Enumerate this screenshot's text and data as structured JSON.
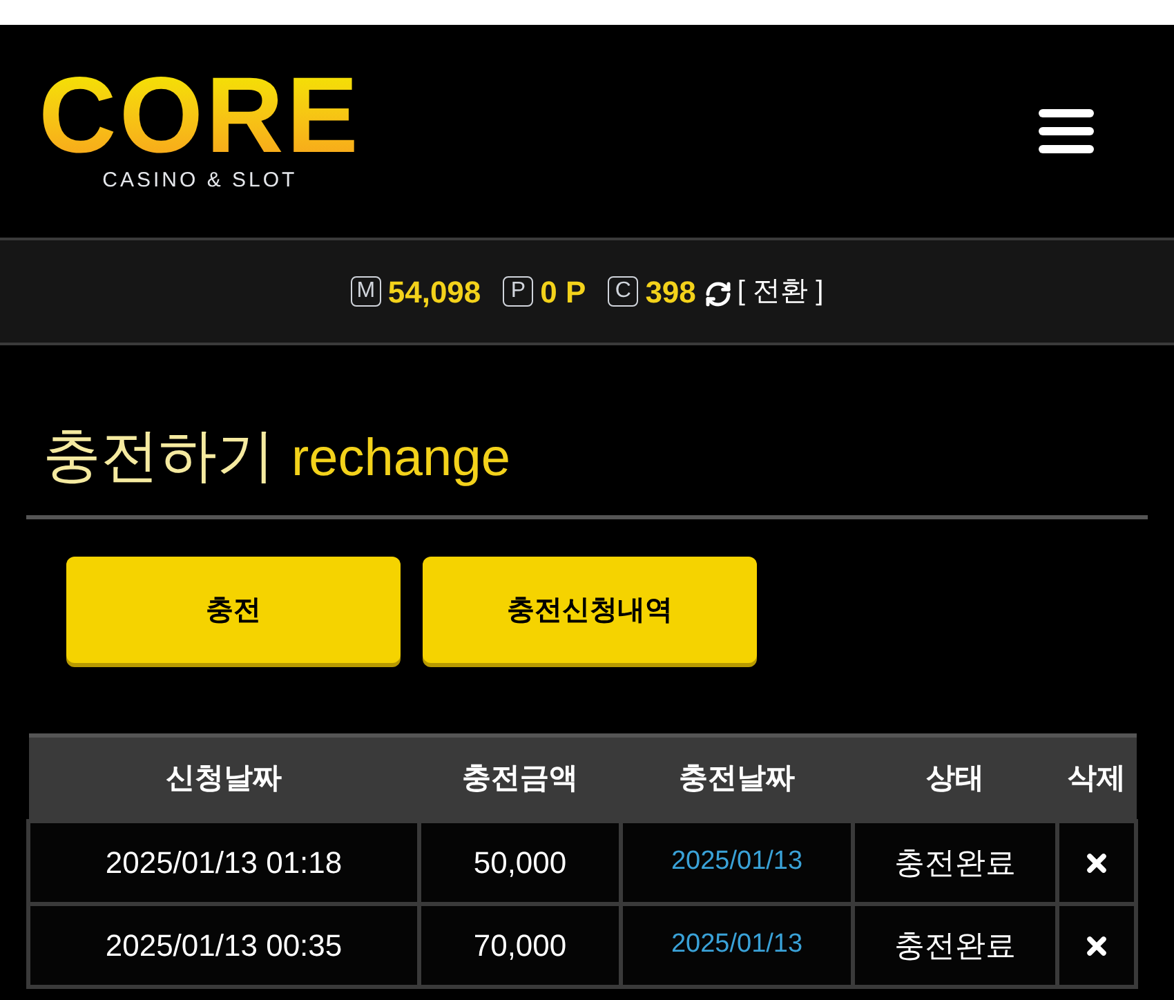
{
  "logo": {
    "wordmark": "CORE",
    "tagline": "CASINO & SLOT"
  },
  "balance": {
    "items": [
      {
        "badge": "M",
        "value": "54,098"
      },
      {
        "badge": "P",
        "value": "0 P"
      },
      {
        "badge": "C",
        "value": "398"
      }
    ],
    "convert": "[ 전환 ]"
  },
  "page_title": {
    "korean": "충전하기",
    "english": "rechange"
  },
  "buttons": [
    "충전",
    "충전신청내역"
  ],
  "table": {
    "columns": [
      "신청날짜",
      "충전금액",
      "충전날짜",
      "상태",
      "삭제"
    ],
    "rows": [
      {
        "requested": "2025/01/13 01:18",
        "amount": "50,000",
        "charged": "2025/01/13",
        "status": "충전완료"
      },
      {
        "requested": "2025/01/13 00:35",
        "amount": "70,000",
        "charged": "2025/01/13",
        "status": "충전완료"
      }
    ]
  }
}
